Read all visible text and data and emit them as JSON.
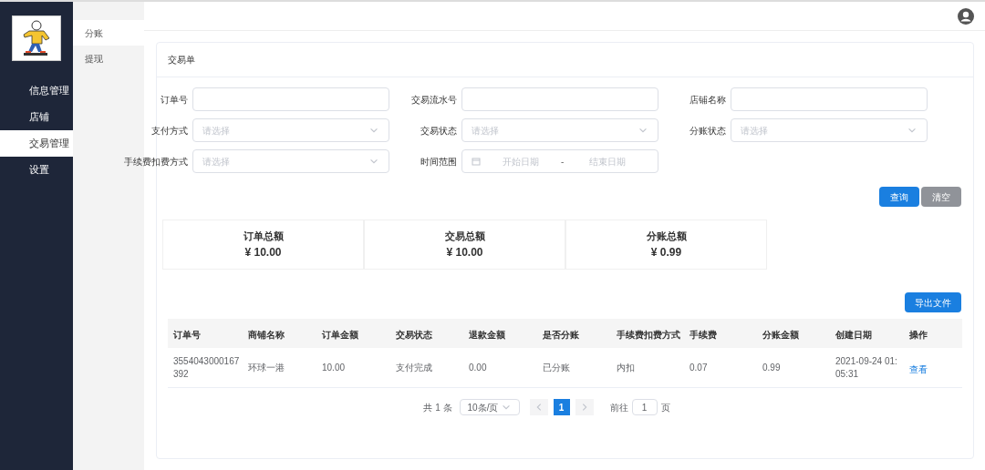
{
  "sidebar": {
    "items": [
      {
        "label": "信息管理",
        "selected": false
      },
      {
        "label": "店铺",
        "selected": false
      },
      {
        "label": "交易管理",
        "selected": true
      },
      {
        "label": "设置",
        "selected": false
      }
    ]
  },
  "submenu": {
    "items": [
      {
        "label": "分账",
        "selected": true
      },
      {
        "label": "提现",
        "selected": false
      }
    ]
  },
  "card": {
    "title": "交易单"
  },
  "filters": [
    {
      "kind": "text",
      "label": "订单号"
    },
    {
      "kind": "text",
      "label": "交易流水号"
    },
    {
      "kind": "text",
      "label": "店铺名称"
    },
    {
      "kind": "select",
      "label": "支付方式",
      "placeholder": "请选择"
    },
    {
      "kind": "select",
      "label": "交易状态",
      "placeholder": "请选择"
    },
    {
      "kind": "select",
      "label": "分账状态",
      "placeholder": "请选择"
    },
    {
      "kind": "select",
      "label": "手续费扣费方式",
      "placeholder": "请选择"
    },
    {
      "kind": "daterange",
      "label": "时间范围",
      "start_placeholder": "开始日期",
      "separator": "-",
      "end_placeholder": "结束日期"
    }
  ],
  "buttons": [
    {
      "label": "查询",
      "kind": "primary"
    },
    {
      "label": "清空",
      "kind": "secondary"
    }
  ],
  "summary": [
    {
      "label": "订单总额",
      "value": "¥ 10.00"
    },
    {
      "label": "交易总额",
      "value": "¥ 10.00"
    },
    {
      "label": "分账总额",
      "value": "¥ 0.99"
    }
  ],
  "export_button": "导出文件",
  "table": {
    "columns": [
      "订单号",
      "商铺名称",
      "订单金额",
      "交易状态",
      "退款金额",
      "是否分账",
      "手续费扣费方式",
      "手续费",
      "分账金额",
      "创建日期",
      "操作"
    ],
    "rows": [
      {
        "cells": [
          "3554043000167392",
          "环球一港",
          "10.00",
          "支付完成",
          "0.00",
          "已分账",
          "内扣",
          "0.07",
          "0.99",
          "2021-09-24 01:05:31"
        ],
        "action": "查看"
      }
    ]
  },
  "pagination": {
    "total": "共 1 条",
    "page_size": "10条/页",
    "pages": [
      {
        "label": "1",
        "selected": true
      }
    ],
    "goto_label": "前往",
    "goto_value": "1",
    "goto_suffix": "页"
  }
}
